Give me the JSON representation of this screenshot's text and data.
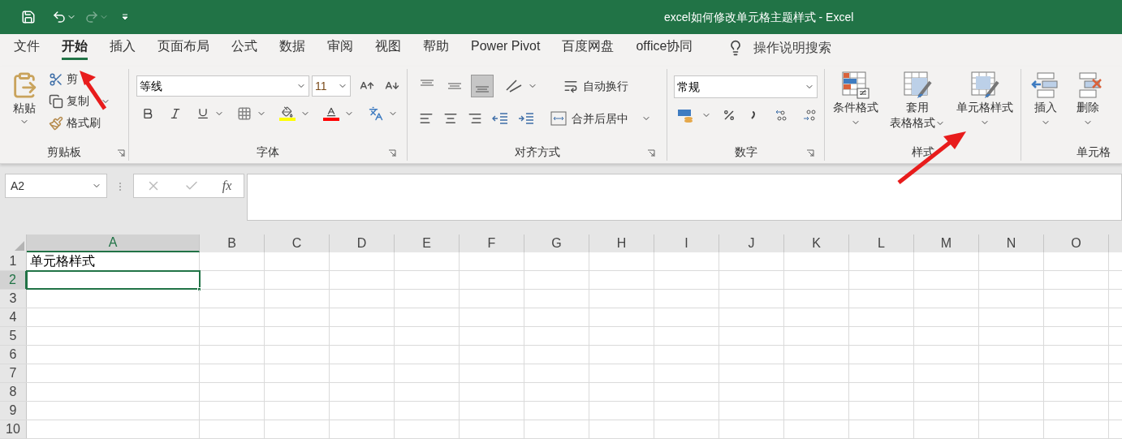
{
  "window": {
    "title": "excel如何修改单元格主题样式 - Excel"
  },
  "tabs": [
    {
      "label": "文件",
      "selected": false
    },
    {
      "label": "开始",
      "selected": true
    },
    {
      "label": "插入",
      "selected": false
    },
    {
      "label": "页面布局",
      "selected": false
    },
    {
      "label": "公式",
      "selected": false
    },
    {
      "label": "数据",
      "selected": false
    },
    {
      "label": "审阅",
      "selected": false
    },
    {
      "label": "视图",
      "selected": false
    },
    {
      "label": "帮助",
      "selected": false
    },
    {
      "label": "Power Pivot",
      "selected": false
    },
    {
      "label": "百度网盘",
      "selected": false
    },
    {
      "label": "office协同",
      "selected": false
    }
  ],
  "tell_me": {
    "placeholder": "操作说明搜索"
  },
  "ribbon": {
    "clipboard": {
      "label": "剪贴板",
      "paste": "粘贴",
      "cut": "剪",
      "copy": "复制",
      "format_painter": "格式刷"
    },
    "font": {
      "label": "字体",
      "font_name": "等线",
      "font_size": "11"
    },
    "alignment": {
      "label": "对齐方式",
      "vertical": [
        {
          "selected": false
        },
        {
          "selected": false
        },
        {
          "selected": true
        }
      ],
      "wrap_text": "自动换行",
      "merge_center": "合并后居中"
    },
    "number": {
      "label": "数字",
      "format": "常规"
    },
    "styles": {
      "label": "样式",
      "buttons": [
        {
          "label": "条件格式"
        },
        {
          "label": "套用",
          "second_line": "表格格式"
        },
        {
          "label": "单元格样式"
        }
      ]
    },
    "cells": {
      "label": "单元格",
      "buttons": [
        {
          "label": "插入"
        },
        {
          "label": "删除"
        }
      ]
    }
  },
  "formula_bar": {
    "name_box": "A2",
    "fx": "fx"
  },
  "sheet": {
    "columns": [
      {
        "label": "A",
        "selected": true
      },
      {
        "label": "B",
        "selected": false
      },
      {
        "label": "C",
        "selected": false
      },
      {
        "label": "D",
        "selected": false
      },
      {
        "label": "E",
        "selected": false
      },
      {
        "label": "F",
        "selected": false
      },
      {
        "label": "G",
        "selected": false
      },
      {
        "label": "H",
        "selected": false
      },
      {
        "label": "I",
        "selected": false
      },
      {
        "label": "J",
        "selected": false
      },
      {
        "label": "K",
        "selected": false
      },
      {
        "label": "L",
        "selected": false
      },
      {
        "label": "M",
        "selected": false
      },
      {
        "label": "N",
        "selected": false
      },
      {
        "label": "O",
        "selected": false
      }
    ],
    "rows": [
      {
        "label": "1",
        "selected": false,
        "cells": [
          "单元格样式"
        ]
      },
      {
        "label": "2",
        "selected": true
      },
      {
        "label": "3",
        "selected": false
      },
      {
        "label": "4",
        "selected": false
      },
      {
        "label": "5",
        "selected": false
      },
      {
        "label": "6",
        "selected": false
      },
      {
        "label": "7",
        "selected": false
      },
      {
        "label": "8",
        "selected": false
      },
      {
        "label": "9",
        "selected": false
      },
      {
        "label": "10",
        "selected": false
      }
    ]
  }
}
